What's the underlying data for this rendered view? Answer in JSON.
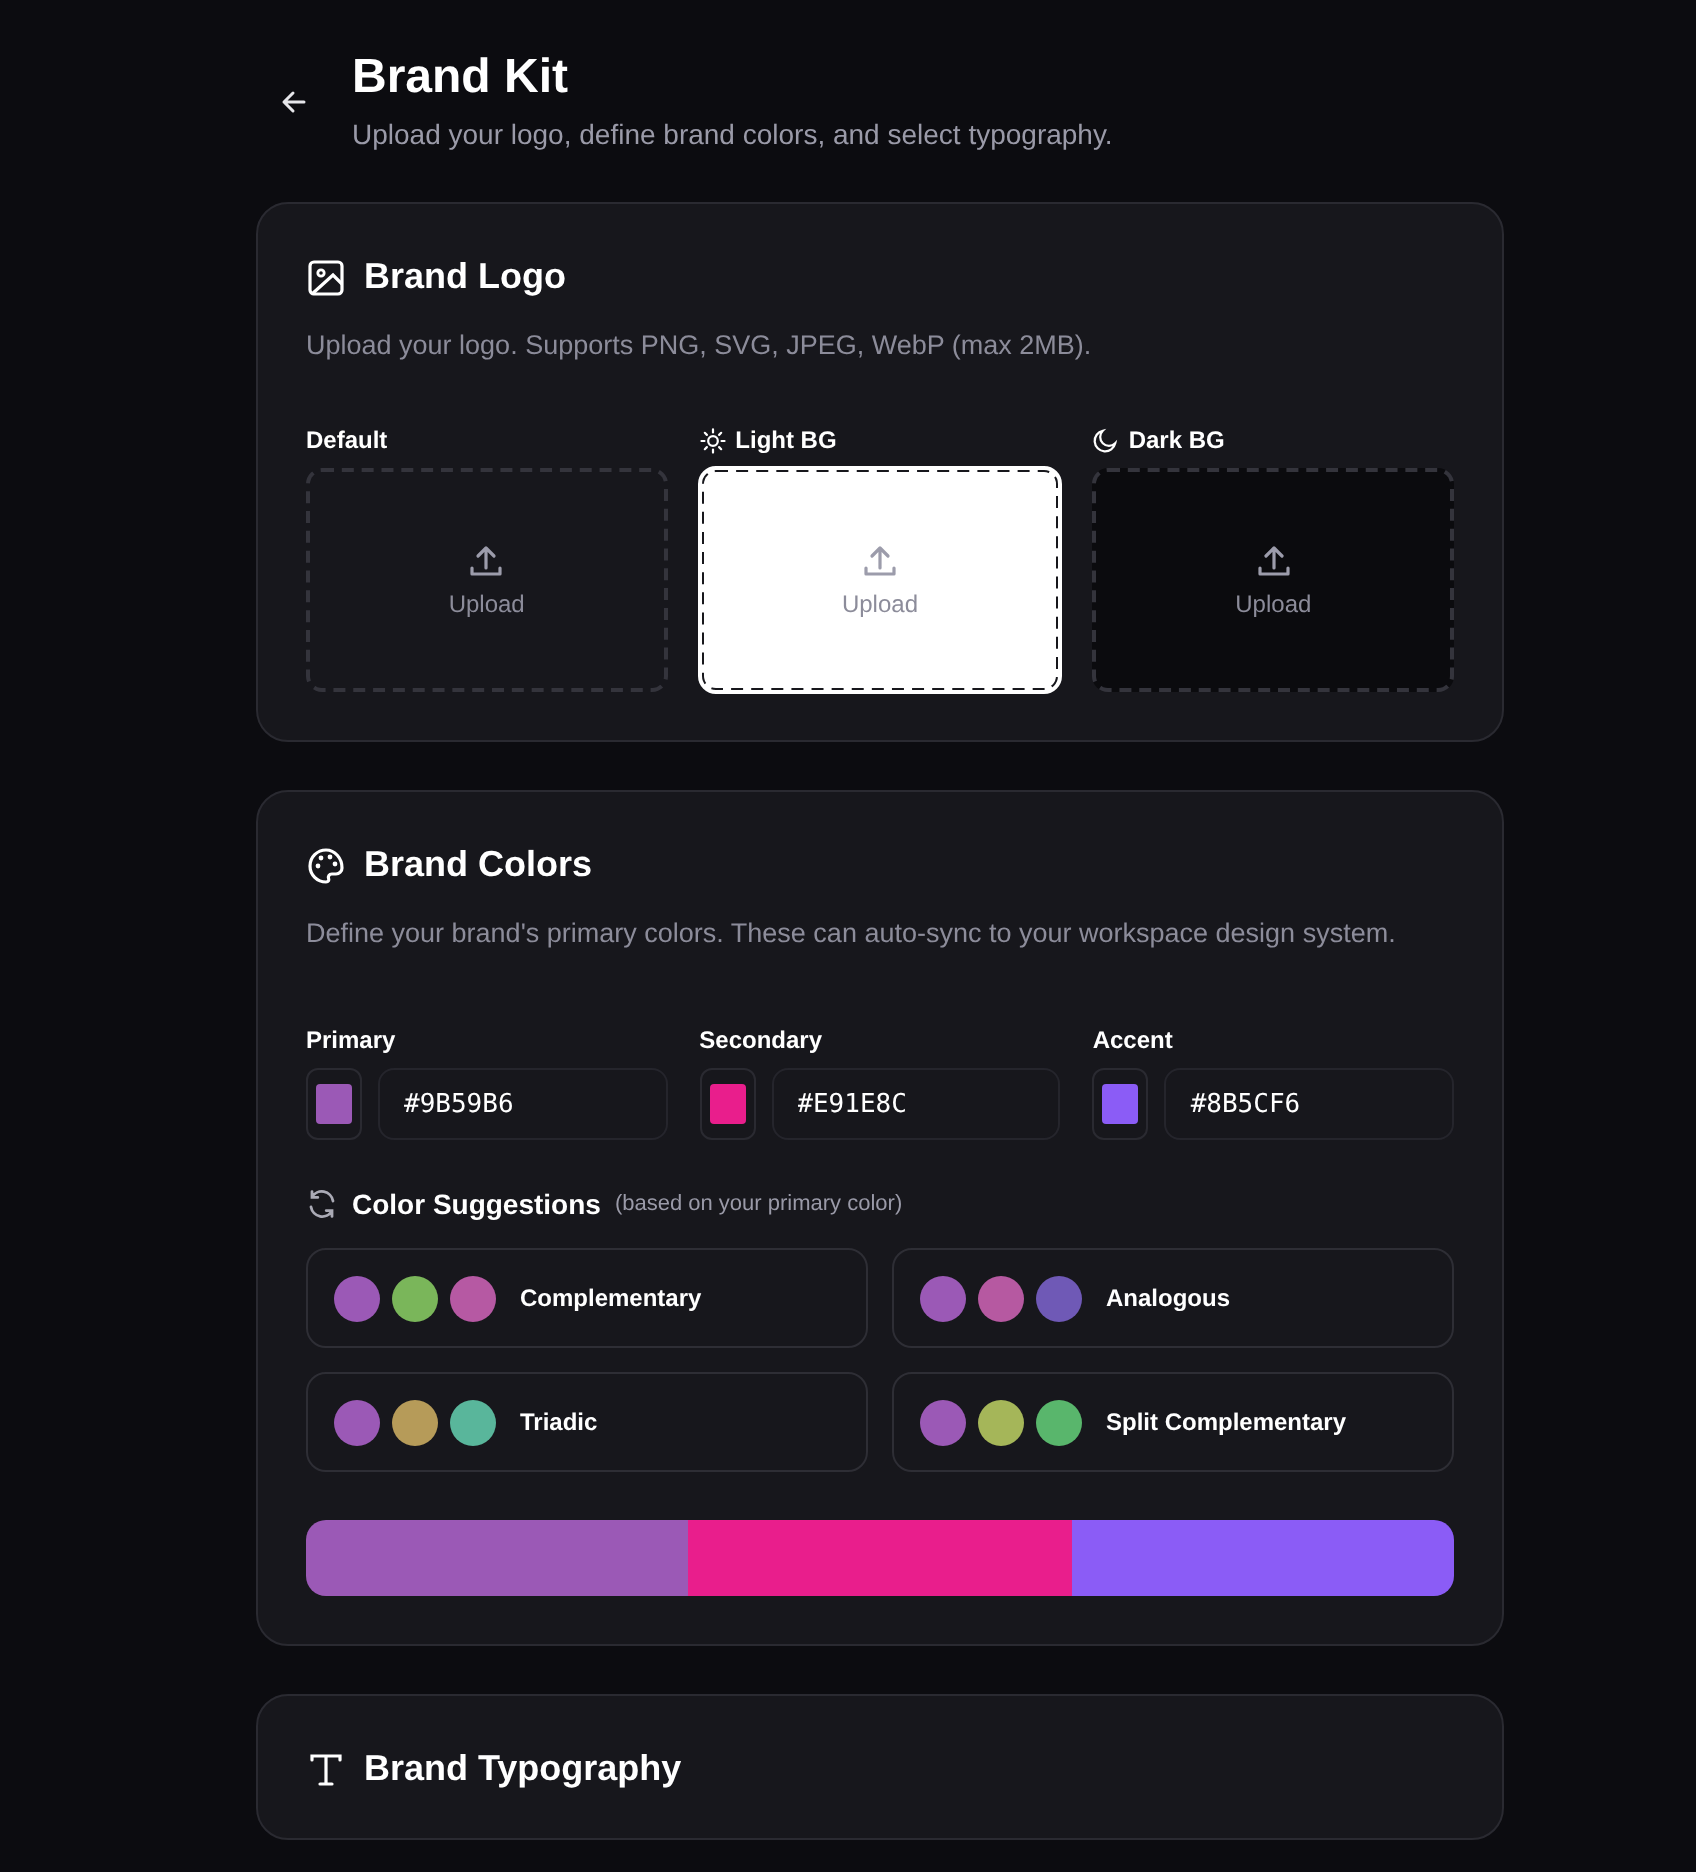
{
  "header": {
    "title": "Brand Kit",
    "subtitle": "Upload your logo, define brand colors, and select typography."
  },
  "logo_card": {
    "title": "Brand Logo",
    "description": "Upload your logo. Supports PNG, SVG, JPEG, WebP (max 2MB).",
    "slots": [
      {
        "kind": "default",
        "label": "Default",
        "action": "Upload"
      },
      {
        "kind": "light",
        "label": "Light BG",
        "action": "Upload"
      },
      {
        "kind": "dark",
        "label": "Dark BG",
        "action": "Upload"
      }
    ]
  },
  "colors_card": {
    "title": "Brand Colors",
    "description": "Define your brand's primary colors. These can auto-sync to your workspace design system.",
    "colors": [
      {
        "label": "Primary",
        "value": "#9B59B6",
        "color": "#9b59b6"
      },
      {
        "label": "Secondary",
        "value": "#E91E8C",
        "color": "#e91e8c"
      },
      {
        "label": "Accent",
        "value": "#8B5CF6",
        "color": "#8b5cf6"
      }
    ],
    "suggestions_title": "Color Suggestions",
    "suggestions_hint": "(based on your primary color)",
    "suggestions": [
      {
        "name": "Complementary",
        "swatches": [
          {
            "color": "#9b59b6"
          },
          {
            "color": "#7ab65a"
          },
          {
            "color": "#b659a3"
          }
        ]
      },
      {
        "name": "Analogous",
        "swatches": [
          {
            "color": "#9b59b6"
          },
          {
            "color": "#b659a1"
          },
          {
            "color": "#6f59b6"
          }
        ]
      },
      {
        "name": "Triadic",
        "swatches": [
          {
            "color": "#9b59b6"
          },
          {
            "color": "#b69b59"
          },
          {
            "color": "#59b69b"
          }
        ]
      },
      {
        "name": "Split Complementary",
        "swatches": [
          {
            "color": "#9b59b6"
          },
          {
            "color": "#a5b659"
          },
          {
            "color": "#59b66c"
          }
        ]
      }
    ]
  },
  "typography_card": {
    "title": "Brand Typography"
  }
}
